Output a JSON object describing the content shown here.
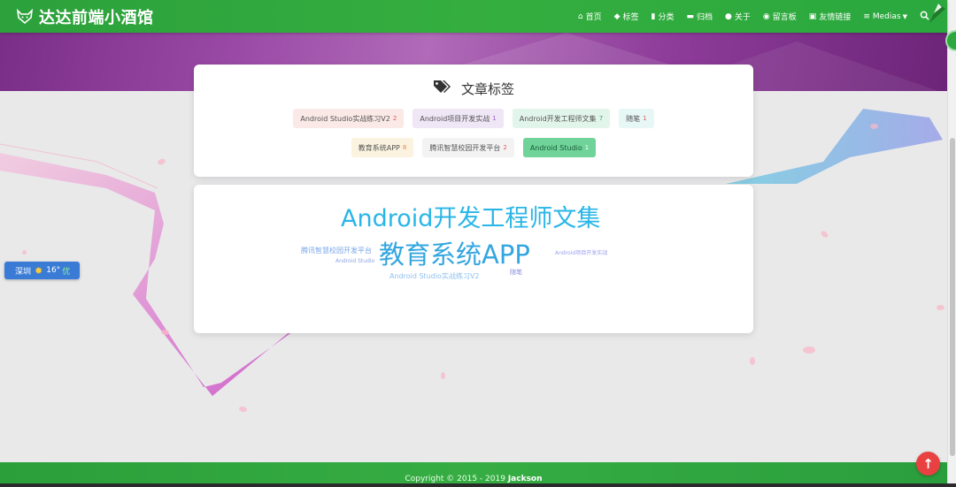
{
  "header": {
    "site_title": "达达前端小酒馆",
    "nav": [
      {
        "icon": "home-icon",
        "glyph": "⌂",
        "label": "首页"
      },
      {
        "icon": "tags-icon",
        "glyph": "◆",
        "label": "标签"
      },
      {
        "icon": "bookmark-icon",
        "glyph": "▮",
        "label": "分类"
      },
      {
        "icon": "archive-icon",
        "glyph": "▬",
        "label": "归档"
      },
      {
        "icon": "user-circle-icon",
        "glyph": "●",
        "label": "关于"
      },
      {
        "icon": "comments-icon",
        "glyph": "◉",
        "label": "留言板"
      },
      {
        "icon": "link-icon",
        "glyph": "▣",
        "label": "友情链接"
      },
      {
        "icon": "list-icon",
        "glyph": "≡",
        "label": "Medias"
      }
    ],
    "search_icon": "search-icon"
  },
  "tags_card": {
    "title": "文章标签",
    "row1": [
      {
        "name": "Android Studio实战练习V2",
        "count": "2"
      },
      {
        "name": "Android项目开发实战",
        "count": "1"
      },
      {
        "name": "Android开发工程师文集",
        "count": "7"
      },
      {
        "name": "随笔",
        "count": "1"
      }
    ],
    "row2": [
      {
        "name": "教育系统APP",
        "count": "8"
      },
      {
        "name": "腾讯智慧校园开发平台",
        "count": "2"
      },
      {
        "name": "Android Studio",
        "count": "1"
      }
    ]
  },
  "cloud": {
    "w1": "Android开发工程师文集",
    "w2": "教育系统APP",
    "w3": "腾讯智慧校园开发平台",
    "w4": "Android Studio",
    "w5": "Android项目开发实战",
    "w6": "Android Studio实战练习V2",
    "w7": "随笔"
  },
  "weather": {
    "city": "深圳",
    "temp": "16°",
    "quality": "优"
  },
  "footer": {
    "copyright": "Copyright © 2015 - 2019",
    "author": "Jackson"
  },
  "colors": {
    "nav_green": "#2ca13c",
    "cloud_blue": "#29b6e6",
    "back_top_red": "#e94141"
  }
}
